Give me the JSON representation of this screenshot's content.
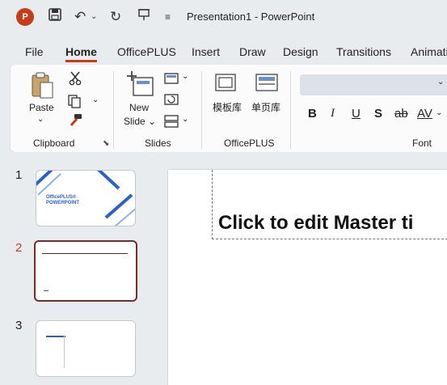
{
  "app": {
    "logo_letter": "P",
    "title": "Presentation1 - PowerPoint",
    "accent": "#c43e1c"
  },
  "quick_access": [
    "save-icon",
    "undo-icon",
    "redo-icon",
    "present-icon",
    "customize-icon"
  ],
  "tabs": [
    "File",
    "Home",
    "OfficePLUS",
    "Insert",
    "Draw",
    "Design",
    "Transitions",
    "Animations"
  ],
  "active_tab": "Home",
  "ribbon": {
    "clipboard": {
      "paste": "Paste",
      "label": "Clipboard"
    },
    "slides": {
      "new_slide_line1": "New",
      "new_slide_line2": "Slide",
      "label": "Slides"
    },
    "officeplus": {
      "template_lib": "模板库",
      "page_lib": "单页库",
      "label": "OfficePLUS"
    },
    "font": {
      "bold": "B",
      "italic": "I",
      "underline": "U",
      "shadow": "S",
      "strike": "ab",
      "spacing": "AV",
      "label": "Font"
    }
  },
  "thumbnails": [
    {
      "number": "1",
      "caption_line1": "OfficePLUS®",
      "caption_line2": "POWERPOINT"
    },
    {
      "number": "2"
    },
    {
      "number": "3"
    }
  ],
  "editor": {
    "placeholder_title": "Click to edit Master ti"
  }
}
